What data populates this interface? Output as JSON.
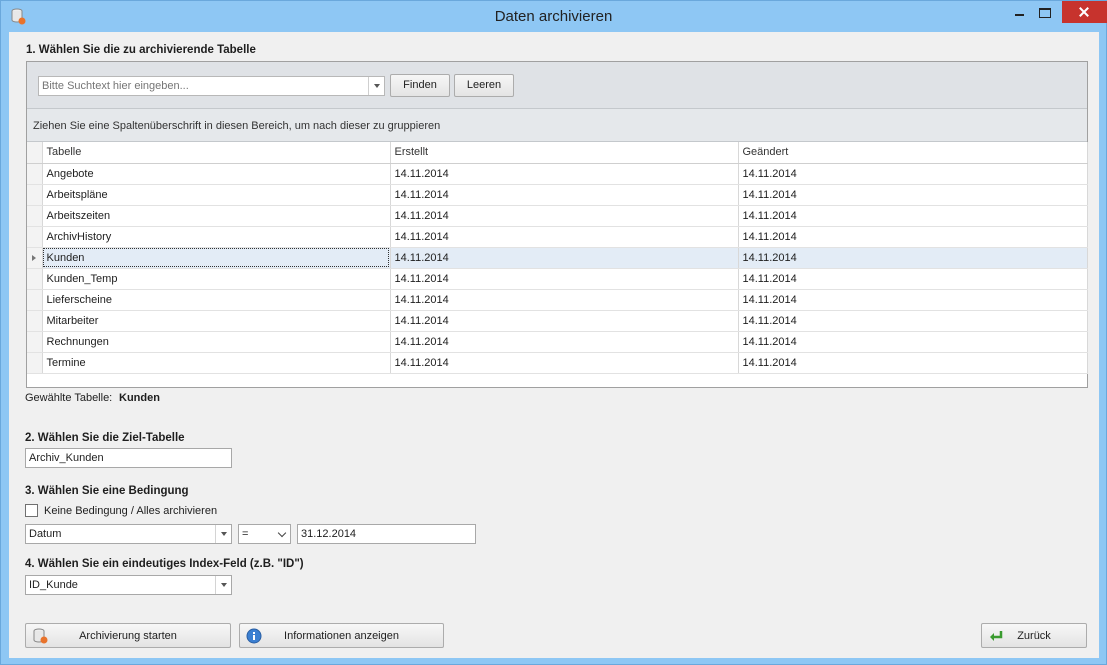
{
  "window": {
    "title": "Daten archivieren"
  },
  "step1": {
    "title": "1. Wählen Sie die zu archivierende Tabelle",
    "search": {
      "placeholder": "Bitte Suchtext hier eingeben...",
      "find_label": "Finden",
      "clear_label": "Leeren"
    },
    "group_hint": "Ziehen Sie eine Spaltenüberschrift in diesen Bereich, um nach dieser zu gruppieren",
    "columns": [
      "Tabelle",
      "Erstellt",
      "Geändert"
    ],
    "rows": [
      [
        "Angebote",
        "14.11.2014",
        "14.11.2014"
      ],
      [
        "Arbeitspläne",
        "14.11.2014",
        "14.11.2014"
      ],
      [
        "Arbeitszeiten",
        "14.11.2014",
        "14.11.2014"
      ],
      [
        "ArchivHistory",
        "14.11.2014",
        "14.11.2014"
      ],
      [
        "Kunden",
        "14.11.2014",
        "14.11.2014"
      ],
      [
        "Kunden_Temp",
        "14.11.2014",
        "14.11.2014"
      ],
      [
        "Lieferscheine",
        "14.11.2014",
        "14.11.2014"
      ],
      [
        "Mitarbeiter",
        "14.11.2014",
        "14.11.2014"
      ],
      [
        "Rechnungen",
        "14.11.2014",
        "14.11.2014"
      ],
      [
        "Termine",
        "14.11.2014",
        "14.11.2014"
      ]
    ],
    "selected_label": "Gewählte Tabelle:",
    "selected_value": "Kunden"
  },
  "step2": {
    "title": "2. Wählen Sie die Ziel-Tabelle",
    "value": "Archiv_Kunden"
  },
  "step3": {
    "title": "3. Wählen Sie eine Bedingung",
    "no_condition_label": "Keine Bedingung / Alles archivieren",
    "field": "Datum",
    "operator": "=",
    "value": "31.12.2014"
  },
  "step4": {
    "title": "4. Wählen Sie ein eindeutiges Index-Feld (z.B. \"ID\")",
    "value": "ID_Kunde"
  },
  "actions": {
    "start_label": "Archivierung starten",
    "info_label": "Informationen anzeigen",
    "back_label": "Zurück"
  }
}
